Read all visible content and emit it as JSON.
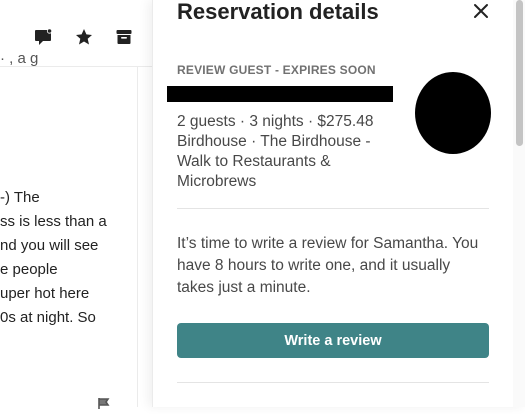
{
  "toolbar": {
    "icons": [
      "message-flag-icon",
      "star-icon",
      "archive-icon"
    ]
  },
  "conversation": {
    "top_fragment": "· ,  a  g",
    "lines": [
      "-) The",
      "ss is less than a",
      "nd you will see",
      "e people",
      "uper hot here",
      "0s at night. So"
    ]
  },
  "details": {
    "title": "Reservation details",
    "status_label": "REVIEW GUEST - EXPIRES SOON",
    "trip_summary": "2 guests · 3 nights · $275.48",
    "listing_title": "Birdhouse · The Birdhouse - Walk to Restaurants & Microbrews",
    "review_message": "It’s time to write a review for Samantha. You have 8 hours to write one, and it usually takes just a minute.",
    "write_review_label": "Write a review"
  },
  "colors": {
    "accent": "#3f8487",
    "text_primary": "#222222",
    "text_secondary": "#484848",
    "label_gray": "#717171"
  }
}
